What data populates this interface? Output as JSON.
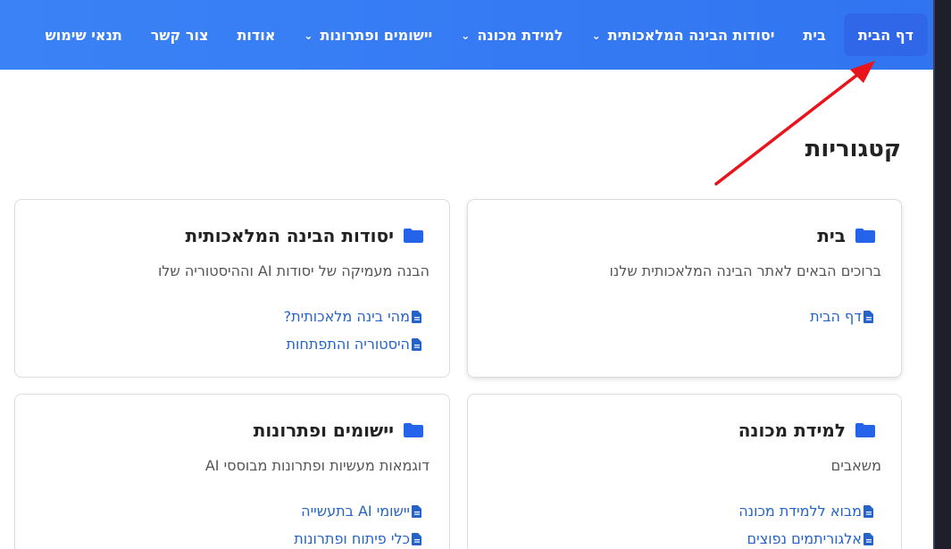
{
  "nav": {
    "items": [
      {
        "label": "דף הבית",
        "active": true,
        "dropdown": false
      },
      {
        "label": "בית",
        "active": false,
        "dropdown": false
      },
      {
        "label": "יסודות הבינה המלאכותית",
        "active": false,
        "dropdown": true
      },
      {
        "label": "למידת מכונה",
        "active": false,
        "dropdown": true
      },
      {
        "label": "יישומים ופתרונות",
        "active": false,
        "dropdown": true
      },
      {
        "label": "אודות",
        "active": false,
        "dropdown": false
      },
      {
        "label": "צור קשר",
        "active": false,
        "dropdown": false
      },
      {
        "label": "תנאי שימוש",
        "active": false,
        "dropdown": false
      }
    ]
  },
  "main": {
    "heading": "קטגוריות",
    "cards": [
      {
        "title": "בית",
        "description": "ברוכים הבאים לאתר הבינה המלאכותית שלנו",
        "links": [
          "דף הבית"
        ]
      },
      {
        "title": "יסודות הבינה המלאכותית",
        "description": "הבנה מעמיקה של יסודות AI וההיסטוריה שלו",
        "links": [
          "מהי בינה מלאכותית?",
          "היסטוריה והתפתחות"
        ]
      },
      {
        "title": "למידת מכונה",
        "description": "משאבים",
        "links": [
          "מבוא ללמידת מכונה",
          "אלגוריתמים נפוצים"
        ]
      },
      {
        "title": "יישומים ופתרונות",
        "description": "דוגמאות מעשיות ופתרונות מבוססי AI",
        "links": [
          "יישומי AI בתעשייה",
          "כלי פיתוח ופתרונות"
        ]
      }
    ]
  },
  "colors": {
    "nav_bg": "#3b82f6",
    "link": "#2563c9",
    "folder": "#2563eb",
    "annotation_arrow": "#e8131b"
  },
  "icons": {
    "category": "folder-icon",
    "link": "file-document-icon",
    "dropdown": "chevron-down-icon"
  }
}
